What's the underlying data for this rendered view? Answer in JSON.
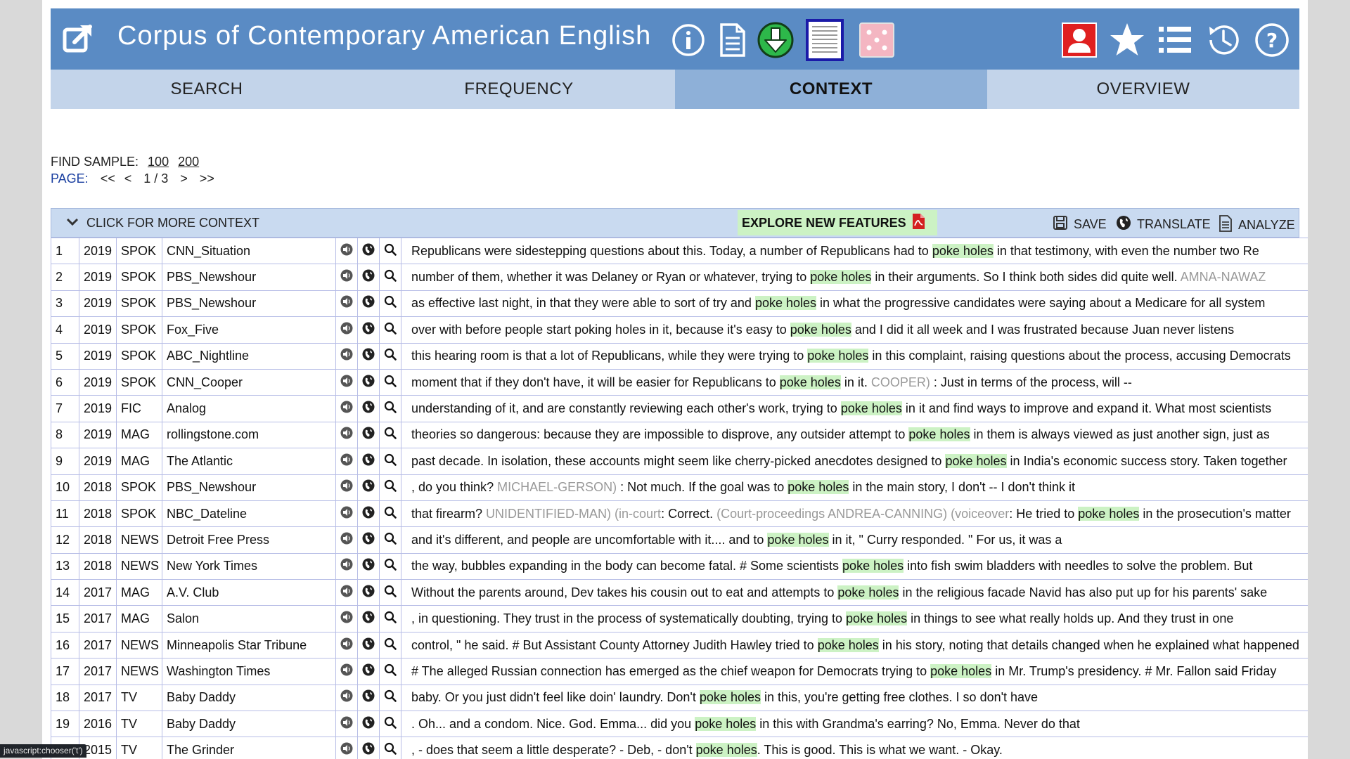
{
  "header": {
    "title": "Corpus of Contemporary American English",
    "colors": {
      "bar": "#5a8bc4",
      "download": "#2db84a",
      "user": "#e02020",
      "dice": "#f4b6c2"
    }
  },
  "tabs": [
    {
      "label": "SEARCH"
    },
    {
      "label": "FREQUENCY"
    },
    {
      "label": "CONTEXT"
    },
    {
      "label": "OVERVIEW"
    }
  ],
  "sample": {
    "label": "FIND SAMPLE:",
    "opt1": "100",
    "opt2": "200"
  },
  "pager": {
    "label": "PAGE:",
    "first": "<<",
    "prev": "<",
    "current": "1 / 3",
    "next": ">",
    "last": ">>"
  },
  "toolbar": {
    "more_context": "CLICK FOR MORE CONTEXT",
    "explore": "EXPLORE NEW FEATURES",
    "save": "SAVE",
    "translate": "TRANSLATE",
    "analyze": "ANALYZE"
  },
  "rows": [
    {
      "num": "1",
      "year": "2019",
      "genre": "SPOK",
      "source": "CNN_Situation",
      "pre": "Republicans were sidestepping questions about this. Today, a number of Republicans had to ",
      "post": " in that testimony, with even the number two Re"
    },
    {
      "num": "2",
      "year": "2019",
      "genre": "SPOK",
      "source": "PBS_Newshour",
      "pre": "number of them, whether it was Delaney or Ryan or whatever, trying to ",
      "post": " in their arguments. So I think both sides did quite well. ",
      "post_speaker": "AMNA-NAWAZ"
    },
    {
      "num": "3",
      "year": "2019",
      "genre": "SPOK",
      "source": "PBS_Newshour",
      "pre": "as effective last night, in that they were able to sort of try and ",
      "post": " in what the progressive candidates were saying about a Medicare for all system"
    },
    {
      "num": "4",
      "year": "2019",
      "genre": "SPOK",
      "source": "Fox_Five",
      "pre": "over with before people start poking holes in it, because it's easy to ",
      "post": " and I did it all week and I was frustrated because Juan never listens"
    },
    {
      "num": "5",
      "year": "2019",
      "genre": "SPOK",
      "source": "ABC_Nightline",
      "pre": "this hearing room is that a lot of Republicans, while they were trying to ",
      "post": " in this complaint, raising questions about the process, accusing Democrats"
    },
    {
      "num": "6",
      "year": "2019",
      "genre": "SPOK",
      "source": "CNN_Cooper",
      "pre": "moment that if they don't have, it will be easier for Republicans to ",
      "post": " in it. ",
      "post_speaker": "COOPER)",
      "post_tail": " : Just in terms of the process, will --"
    },
    {
      "num": "7",
      "year": "2019",
      "genre": "FIC",
      "source": "Analog",
      "pre": "understanding of it, and are constantly reviewing each other's work, trying to ",
      "post": " in it and find ways to improve and expand it. What most scientists"
    },
    {
      "num": "8",
      "year": "2019",
      "genre": "MAG",
      "source": "rollingstone.com",
      "pre": "theories so dangerous: because they are impossible to disprove, any outsider attempt to ",
      "post": " in them is always viewed as just another sign, just as"
    },
    {
      "num": "9",
      "year": "2019",
      "genre": "MAG",
      "source": "The Atlantic",
      "pre": "past decade. In isolation, these accounts might seem like cherry-picked anecdotes designed to ",
      "post": " in India's economic success story. Taken together"
    },
    {
      "num": "10",
      "year": "2018",
      "genre": "SPOK",
      "source": "PBS_Newshour",
      "pre": ", do you think? ",
      "pre_speaker": "MICHAEL-GERSON)",
      "pre_tail": " : Not much. If the goal was to ",
      "post": " in the main story, I don't -- I don't think it"
    },
    {
      "num": "11",
      "year": "2018",
      "genre": "SPOK",
      "source": "NBC_Dateline",
      "pre": "that firearm? ",
      "pre_speaker": "UNIDENTIFIED-MAN) (in-court",
      "pre_tail": ": Correct. ",
      "pre_speaker2": "(Court-proceedings ANDREA-CANNING) (voiceover",
      "pre_tail2": ": He tried to ",
      "post": " in the prosecution's matter"
    },
    {
      "num": "12",
      "year": "2018",
      "genre": "NEWS",
      "source": "Detroit Free Press",
      "pre": "and it's different, and people are uncomfortable with it.... and to ",
      "post": " in it, \" Curry responded. \" For us, it was a"
    },
    {
      "num": "13",
      "year": "2018",
      "genre": "NEWS",
      "source": "New York Times",
      "pre": "the way, bubbles expanding in the body can become fatal. # Some scientists ",
      "post": " into fish swim bladders with needles to solve the problem. But"
    },
    {
      "num": "14",
      "year": "2017",
      "genre": "MAG",
      "source": "A.V. Club",
      "pre": "Without the parents around, Dev takes his cousin out to eat and attempts to ",
      "post": " in the religious facade Navid has also put up for his parents' sake"
    },
    {
      "num": "15",
      "year": "2017",
      "genre": "MAG",
      "source": "Salon",
      "pre": ", in questioning. They trust in the process of systematically doubting, trying to ",
      "post": " in things to see what really holds up. And they trust in one"
    },
    {
      "num": "16",
      "year": "2017",
      "genre": "NEWS",
      "source": "Minneapolis Star Tribune",
      "pre": "control, \" he said. # But Assistant County Attorney Judith Hawley tried to ",
      "post": " in his story, noting that details changed when he explained what happened"
    },
    {
      "num": "17",
      "year": "2017",
      "genre": "NEWS",
      "source": "Washington Times",
      "pre": "# The alleged Russian connection has emerged as the chief weapon for Democrats trying to ",
      "post": " in Mr. Trump's presidency. # Mr. Fallon said Friday"
    },
    {
      "num": "18",
      "year": "2017",
      "genre": "TV",
      "source": "Baby Daddy",
      "pre": "baby. Or you just didn't feel like doin' laundry. Don't ",
      "post": " in this, you're getting free clothes. I so don't have"
    },
    {
      "num": "19",
      "year": "2016",
      "genre": "TV",
      "source": "Baby Daddy",
      "pre": ". Oh... and a condom. Nice. God. Emma... did you ",
      "post": " in this with Grandma's earring? No, Emma. Never do that"
    },
    {
      "num": "20",
      "year": "2015",
      "genre": "TV",
      "source": "The Grinder",
      "pre": ", - does that seem a little desperate? - Deb, - don't ",
      "post": ". This is good. This is what we want. - Okay."
    }
  ],
  "keyword": {
    "w1": "poke",
    "w2": "holes"
  },
  "status_bar": "javascript:chooser('t')"
}
